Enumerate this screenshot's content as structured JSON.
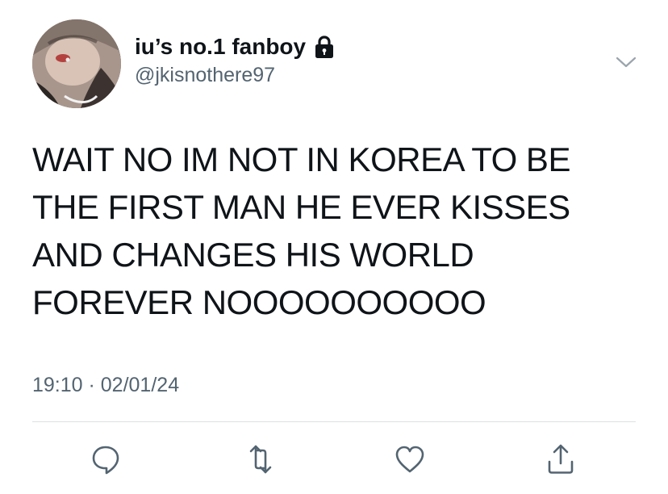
{
  "author": {
    "display_name": "iu’s no.1 fanboy",
    "handle": "@jkisnothere97",
    "protected_icon": "lock-icon"
  },
  "menu": {
    "icon": "chevron-down-icon"
  },
  "tweet": {
    "lines": [
      "WAIT NO IM NOT IN KOREA TO BE",
      "THE FIRST MAN HE EVER KISSES",
      "AND CHANGES HIS WORLD",
      "FOREVER NOOOOOOOOOO"
    ],
    "timestamp": "19:10 · 02/01/24"
  },
  "actions": [
    {
      "name": "reply",
      "icon": "reply-icon"
    },
    {
      "name": "retweet",
      "icon": "retweet-icon"
    },
    {
      "name": "like",
      "icon": "heart-icon"
    },
    {
      "name": "share",
      "icon": "share-icon"
    }
  ],
  "colors": {
    "text": "#0f1419",
    "secondary": "#536471",
    "divider": "#dcdfe2"
  }
}
